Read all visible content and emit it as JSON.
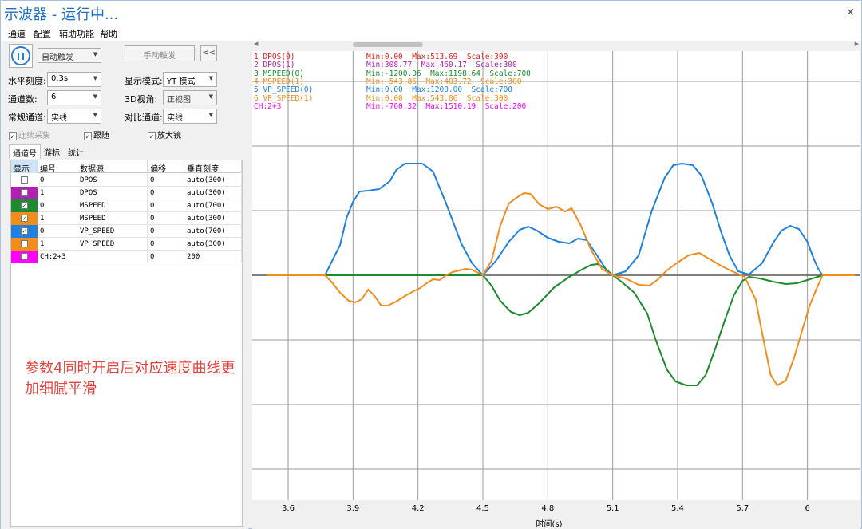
{
  "window": {
    "title": "示波器 - 运行中...",
    "close_glyph": "×"
  },
  "menu": [
    "通道",
    "配置",
    "辅助功能",
    "帮助"
  ],
  "controls": {
    "trigger_mode": "自动触发",
    "manual_trigger": "手动触发",
    "collapse": "<<",
    "h_scale_label": "水平刻度:",
    "h_scale_value": "0.3s",
    "display_mode_label": "显示模式:",
    "display_mode_value": "YT 模式",
    "channel_count_label": "通道数:",
    "channel_count_value": "6",
    "view3d_label": "3D视角:",
    "view3d_value": "正视图",
    "normal_channel_label": "常规通道:",
    "normal_channel_value": "实线",
    "compare_channel_label": "对比通道:",
    "compare_channel_value": "实线",
    "continuous": "连续采集",
    "follow": "跟随",
    "magnifier": "放大镜"
  },
  "tabs": [
    "通道号",
    "游标",
    "统计"
  ],
  "table": {
    "headers": [
      "显示",
      "编号",
      "数据源",
      "偏移",
      "垂直刻度"
    ],
    "rows": [
      {
        "color": "#ffffff",
        "checked": false,
        "num": "0",
        "source": "DPOS",
        "offset": "0",
        "scale": "auto(300)"
      },
      {
        "color": "#b21fb2",
        "checked": false,
        "num": "1",
        "source": "DPOS",
        "offset": "0",
        "scale": "auto(300)"
      },
      {
        "color": "#1d8a2d",
        "checked": true,
        "num": "0",
        "source": "MSPEED",
        "offset": "0",
        "scale": "auto(700)"
      },
      {
        "color": "#f28c1b",
        "checked": true,
        "num": "1",
        "source": "MSPEED",
        "offset": "0",
        "scale": "auto(300)"
      },
      {
        "color": "#1f80e0",
        "checked": true,
        "num": "0",
        "source": "VP_SPEED",
        "offset": "0",
        "scale": "auto(700)"
      },
      {
        "color": "#f28c1b",
        "checked": false,
        "num": "1",
        "source": "VP_SPEED",
        "offset": "0",
        "scale": "auto(300)"
      },
      {
        "color": "#ff00ff",
        "checked": false,
        "num": "CH:2+3",
        "source": "",
        "offset": "0",
        "scale": "200"
      }
    ]
  },
  "annotation": "参数4同时开启后对应速度曲线更加细腻平滑",
  "channel_info": [
    {
      "name": "1 DPOS(0)",
      "stats": "Min:0.00  Max:513.69  Scale:300",
      "color": "#e0201e"
    },
    {
      "name": "2 DPOS(1)",
      "stats": "Min:308.77  Max:460.17  Scale:300",
      "color": "#b21fb2"
    },
    {
      "name": "3 MSPEED(0)",
      "stats": "Min:-1200.06  Max:1198.64  Scale:700",
      "color": "#1d8a2d"
    },
    {
      "name": "4 MSPEED(1)",
      "stats": "Min:-543.86  Max:403.72  Scale:300",
      "color": "#f28c1b"
    },
    {
      "name": "5 VP_SPEED(0)",
      "stats": "Min:0.00  Max:1200.00  Scale:700",
      "color": "#1f80e0"
    },
    {
      "name": "6 VP_SPEED(1)",
      "stats": "Min:0.00  Max:543.86  Scale:300",
      "color": "#f28c1b"
    },
    {
      "name": "CH:2+3",
      "stats": "Min:-760.32  Max:1510.19  Scale:200",
      "color": "#ff00ff"
    }
  ],
  "x_axis": {
    "label": "时间(s)",
    "ticks": [
      "3.6",
      "3.9",
      "4.2",
      "4.5",
      "4.8",
      "5.1",
      "5.4",
      "5.7",
      "6"
    ]
  },
  "chart_data": {
    "type": "line",
    "xlabel": "时间(s)",
    "x_ticks": [
      3.6,
      3.9,
      4.2,
      4.5,
      4.8,
      5.1,
      5.4,
      5.7,
      6.0
    ],
    "series": [
      {
        "name": "5 VP_SPEED(0)",
        "color": "#1f80e0",
        "points": [
          [
            3.5,
            0
          ],
          [
            3.77,
            0
          ],
          [
            3.84,
            380
          ],
          [
            3.87,
            720
          ],
          [
            3.9,
            920
          ],
          [
            3.93,
            1050
          ],
          [
            3.97,
            1060
          ],
          [
            4.02,
            1080
          ],
          [
            4.07,
            1180
          ],
          [
            4.1,
            1320
          ],
          [
            4.14,
            1400
          ],
          [
            4.18,
            1400
          ],
          [
            4.22,
            1400
          ],
          [
            4.27,
            1300
          ],
          [
            4.33,
            900
          ],
          [
            4.4,
            400
          ],
          [
            4.45,
            150
          ],
          [
            4.5,
            0
          ],
          [
            4.56,
            180
          ],
          [
            4.62,
            420
          ],
          [
            4.67,
            570
          ],
          [
            4.71,
            610
          ],
          [
            4.75,
            560
          ],
          [
            4.8,
            470
          ],
          [
            4.85,
            420
          ],
          [
            4.9,
            400
          ],
          [
            4.94,
            460
          ],
          [
            4.98,
            440
          ],
          [
            5.03,
            240
          ],
          [
            5.07,
            70
          ],
          [
            5.1,
            0
          ],
          [
            5.16,
            50
          ],
          [
            5.22,
            250
          ],
          [
            5.28,
            800
          ],
          [
            5.34,
            1220
          ],
          [
            5.38,
            1380
          ],
          [
            5.42,
            1400
          ],
          [
            5.47,
            1380
          ],
          [
            5.51,
            1250
          ],
          [
            5.56,
            900
          ],
          [
            5.6,
            550
          ],
          [
            5.64,
            250
          ],
          [
            5.68,
            50
          ],
          [
            5.73,
            10
          ],
          [
            5.79,
            150
          ],
          [
            5.84,
            400
          ],
          [
            5.88,
            560
          ],
          [
            5.92,
            620
          ],
          [
            5.96,
            580
          ],
          [
            6.0,
            420
          ],
          [
            6.03,
            200
          ],
          [
            6.05,
            80
          ],
          [
            6.07,
            0
          ],
          [
            6.22,
            0
          ]
        ]
      },
      {
        "name": "3 MSPEED(0)",
        "color": "#1d8a2d",
        "points": [
          [
            3.5,
            0
          ],
          [
            4.5,
            0
          ],
          [
            4.54,
            -130
          ],
          [
            4.58,
            -320
          ],
          [
            4.63,
            -460
          ],
          [
            4.67,
            -500
          ],
          [
            4.71,
            -470
          ],
          [
            4.76,
            -350
          ],
          [
            4.83,
            -150
          ],
          [
            4.9,
            -20
          ],
          [
            4.95,
            60
          ],
          [
            5.0,
            130
          ],
          [
            5.03,
            140
          ],
          [
            5.06,
            100
          ],
          [
            5.1,
            0
          ],
          [
            5.14,
            -80
          ],
          [
            5.2,
            -220
          ],
          [
            5.26,
            -480
          ],
          [
            5.3,
            -820
          ],
          [
            5.35,
            -1180
          ],
          [
            5.39,
            -1330
          ],
          [
            5.44,
            -1380
          ],
          [
            5.49,
            -1380
          ],
          [
            5.53,
            -1250
          ],
          [
            5.57,
            -950
          ],
          [
            5.62,
            -550
          ],
          [
            5.66,
            -250
          ],
          [
            5.7,
            -70
          ],
          [
            5.73,
            -20
          ],
          [
            5.78,
            -40
          ],
          [
            5.84,
            -80
          ],
          [
            5.9,
            -110
          ],
          [
            5.95,
            -100
          ],
          [
            6.0,
            -60
          ],
          [
            6.07,
            0
          ],
          [
            6.22,
            0
          ]
        ]
      },
      {
        "name": "4 MSPEED(1)",
        "color": "#f28c1b",
        "points": [
          [
            3.5,
            0
          ],
          [
            3.77,
            0
          ],
          [
            3.8,
            -80
          ],
          [
            3.84,
            -220
          ],
          [
            3.88,
            -320
          ],
          [
            3.91,
            -340
          ],
          [
            3.94,
            -300
          ],
          [
            3.97,
            -180
          ],
          [
            4.0,
            -260
          ],
          [
            4.03,
            -380
          ],
          [
            4.06,
            -380
          ],
          [
            4.1,
            -330
          ],
          [
            4.14,
            -260
          ],
          [
            4.18,
            -200
          ],
          [
            4.21,
            -160
          ],
          [
            4.24,
            -100
          ],
          [
            4.27,
            -50
          ],
          [
            4.3,
            -60
          ],
          [
            4.33,
            0
          ],
          [
            4.36,
            40
          ],
          [
            4.39,
            60
          ],
          [
            4.42,
            80
          ],
          [
            4.45,
            70
          ],
          [
            4.5,
            0
          ],
          [
            4.54,
            180
          ],
          [
            4.58,
            620
          ],
          [
            4.62,
            900
          ],
          [
            4.66,
            980
          ],
          [
            4.69,
            1030
          ],
          [
            4.72,
            1020
          ],
          [
            4.76,
            890
          ],
          [
            4.8,
            830
          ],
          [
            4.84,
            860
          ],
          [
            4.88,
            800
          ],
          [
            4.91,
            840
          ],
          [
            4.95,
            640
          ],
          [
            5.0,
            320
          ],
          [
            5.05,
            80
          ],
          [
            5.1,
            0
          ],
          [
            5.16,
            -40
          ],
          [
            5.22,
            -120
          ],
          [
            5.27,
            -130
          ],
          [
            5.31,
            -50
          ],
          [
            5.35,
            60
          ],
          [
            5.4,
            160
          ],
          [
            5.45,
            250
          ],
          [
            5.5,
            280
          ],
          [
            5.55,
            200
          ],
          [
            5.6,
            120
          ],
          [
            5.66,
            40
          ],
          [
            5.71,
            -20
          ],
          [
            5.76,
            -300
          ],
          [
            5.8,
            -850
          ],
          [
            5.83,
            -1250
          ],
          [
            5.86,
            -1380
          ],
          [
            5.9,
            -1320
          ],
          [
            5.94,
            -1020
          ],
          [
            5.98,
            -650
          ],
          [
            6.01,
            -380
          ],
          [
            6.04,
            -180
          ],
          [
            6.07,
            0
          ],
          [
            6.22,
            0
          ]
        ]
      }
    ]
  }
}
